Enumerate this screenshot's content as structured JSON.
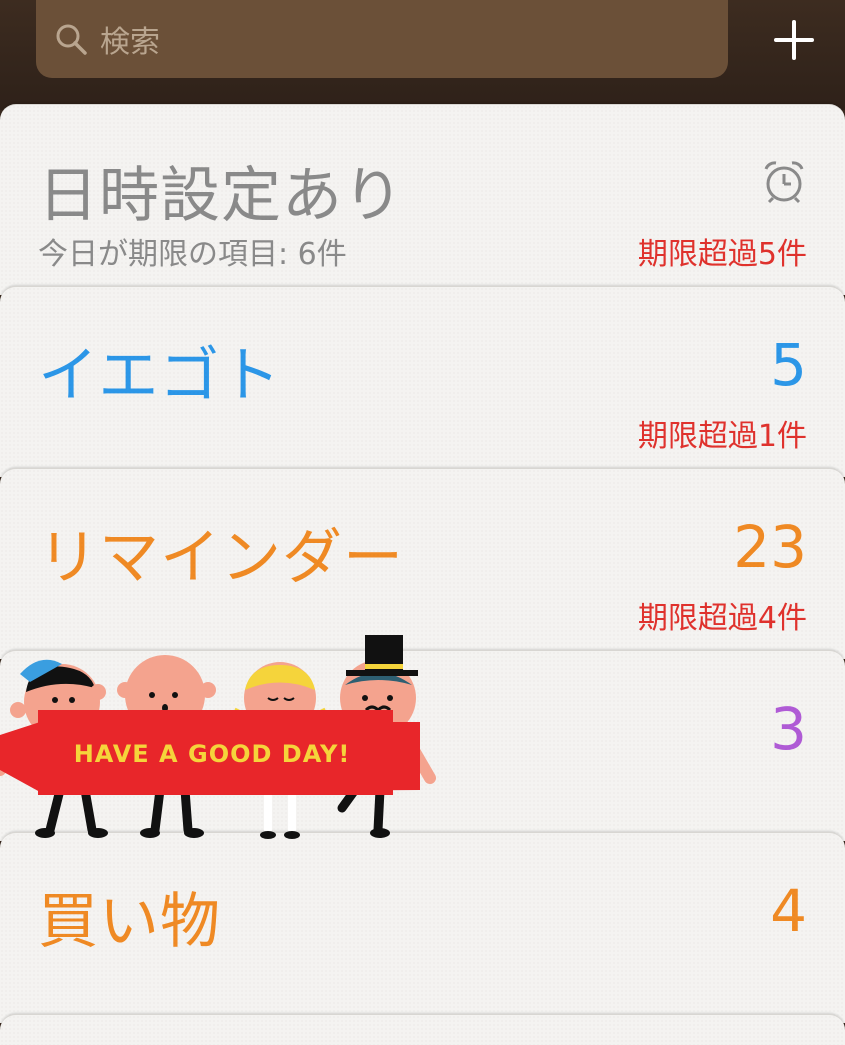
{
  "search": {
    "placeholder": "検索"
  },
  "lists": [
    {
      "title": "日時設定あり",
      "subtitle": "今日が期限の項目: 6件",
      "overdue": "期限超過5件",
      "title_color": "#8a8a8a",
      "icon": "alarm-clock-icon"
    },
    {
      "title": "イエゴト",
      "count": "5",
      "overdue": "期限超過1件",
      "color": "#2c97e8"
    },
    {
      "title": "リマインダー",
      "count": "23",
      "overdue": "期限超過4件",
      "color": "#f08a24"
    },
    {
      "title": "",
      "count": "3",
      "color": "#b05bd6"
    },
    {
      "title": "買い物",
      "count": "4",
      "color": "#f08a24"
    }
  ],
  "banner": {
    "text": "HAVE A GOOD DAY!"
  },
  "colors": {
    "overdue": "#e0322d",
    "topbar": "#3a2a1f",
    "search_bg": "#6b5038"
  },
  "icons": [
    "search-icon",
    "add-icon",
    "alarm-clock-icon"
  ]
}
